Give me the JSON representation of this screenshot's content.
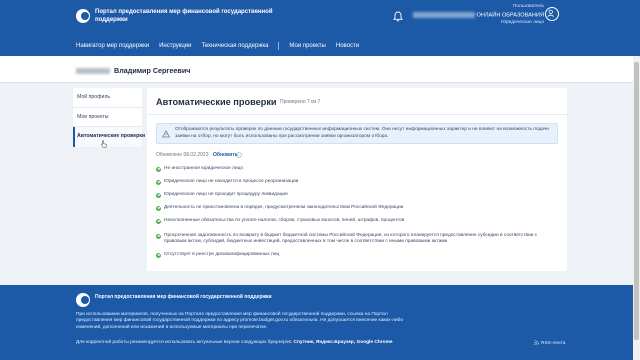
{
  "header": {
    "brand": "Портал предоставления мер финансовой государственной поддержки",
    "user_role": "Пользователь",
    "user_name_visible": "ОНЛАЙН ОБРАЗОВАНИЯ",
    "user_type": "Юридическое лицо",
    "icons": {
      "bell": "bell-icon",
      "avatar": "user-avatar-icon"
    }
  },
  "nav": {
    "items": [
      "Навигатор мер поддержки",
      "Инструкции",
      "Техническая поддержка",
      "Мои проекты",
      "Новости"
    ]
  },
  "profile": {
    "name": "Владимир Сергеевич"
  },
  "sidebar": {
    "items": [
      {
        "label": "Мой профиль"
      },
      {
        "label": "Мои проекты"
      },
      {
        "label": "Автоматические проверки"
      }
    ]
  },
  "main": {
    "title": "Автоматические проверки",
    "progress": "Проверено 7 из 7",
    "notice": "Отображаются результаты проверок по данным государственных информационных систем. Они несут информационных характер и не влияют на возможность подачи заявки на отбор, но могут быть использованы при рассмотрении заявки организатором отбора.",
    "updated": "Обновлено 08.02.2023",
    "refresh_label": "Обновить",
    "checks": [
      "Не иностранное юридическое лицо",
      "Юридическое лицо не находится в процессе реорганизации",
      "Юридическое лицо не проходит процедуру ликвидации",
      "Деятельность не приостановлена в порядке, предусмотренном законодательством Российской Федерации",
      "Неисполненные обязательства по уплате налогов, сборов, страховых взносов, пеней, штрафов, процентов",
      "Просроченная задолженность по возврату в бюджет бюджетной системы Российской Федерации, из которого планируется предоставление субсидии в соответствии с правовым актом, субсидий, бюджетных инвестиций, предоставленных в том числе в соответствии с иными правовыми актами",
      "Отсутствует в реестре дисквалифицированных лиц"
    ],
    "colors": {
      "success": "#4caf50",
      "accent": "#1c5aa8"
    }
  },
  "footer": {
    "brand": "Портал предоставления мер финансовой государственной поддержки",
    "text": "При использовании материалов, полученных на Портале предоставления мер финансовой государственной поддержки, ссылка на Портал предоставления мер финансовой государственной поддержки по адресу promote.budget.gov.ru обязательна. Не допускается внесение каких-либо изменений, дополнений или искажений в используемые материалы при перепечатке.",
    "browsers_prefix": "Для корректной работы рекомендуется использовать актуальные версии следующих браузеров:",
    "browsers": "Спутник, Яндекс.Браузер, Google Chrome",
    "rss": "RSS-лента"
  }
}
